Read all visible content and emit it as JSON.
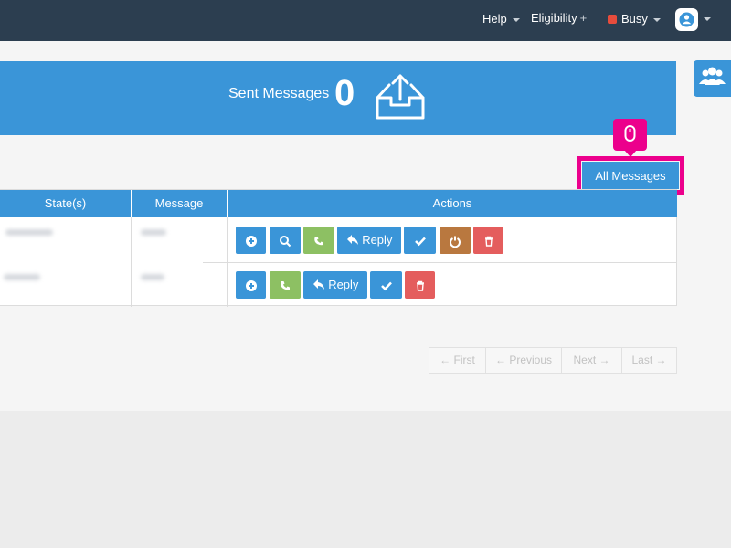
{
  "navbar": {
    "help_label": "Help",
    "eligibility_label": "Eligibility",
    "eligibility_plus": "+",
    "status_label": "Busy",
    "status_color": "#e74c3c",
    "background": "#2c3e50"
  },
  "banner": {
    "label": "Sent Messages",
    "count": "0",
    "icon": "outbox-upload-icon",
    "background": "#3a95d8"
  },
  "side_tab": {
    "icon": "users-icon"
  },
  "tooltip": {
    "icon": "mouse-icon",
    "highlight_color": "#ec008c"
  },
  "all_messages_button": {
    "label": "All Messages"
  },
  "table": {
    "columns": [
      "State(s)",
      "Message",
      "Actions"
    ],
    "rows": [
      {
        "actions": [
          {
            "icon": "plus-circle-icon",
            "color": "blue"
          },
          {
            "icon": "search-icon",
            "color": "blue"
          },
          {
            "icon": "phone-icon",
            "color": "green"
          },
          {
            "icon": "reply-icon",
            "label": "Reply",
            "color": "blue"
          },
          {
            "icon": "check-icon",
            "color": "blue"
          },
          {
            "icon": "power-icon",
            "color": "brown"
          },
          {
            "icon": "trash-icon",
            "color": "red"
          }
        ]
      },
      {
        "actions": [
          {
            "icon": "plus-circle-icon",
            "color": "blue"
          },
          {
            "icon": "phone-icon",
            "color": "green"
          },
          {
            "icon": "reply-icon",
            "label": "Reply",
            "color": "blue"
          },
          {
            "icon": "check-icon",
            "color": "blue"
          },
          {
            "icon": "trash-icon",
            "color": "red"
          }
        ]
      }
    ]
  },
  "pager": {
    "first": "← First",
    "previous": "← Previous",
    "next": "Next →",
    "last": "Last →"
  }
}
